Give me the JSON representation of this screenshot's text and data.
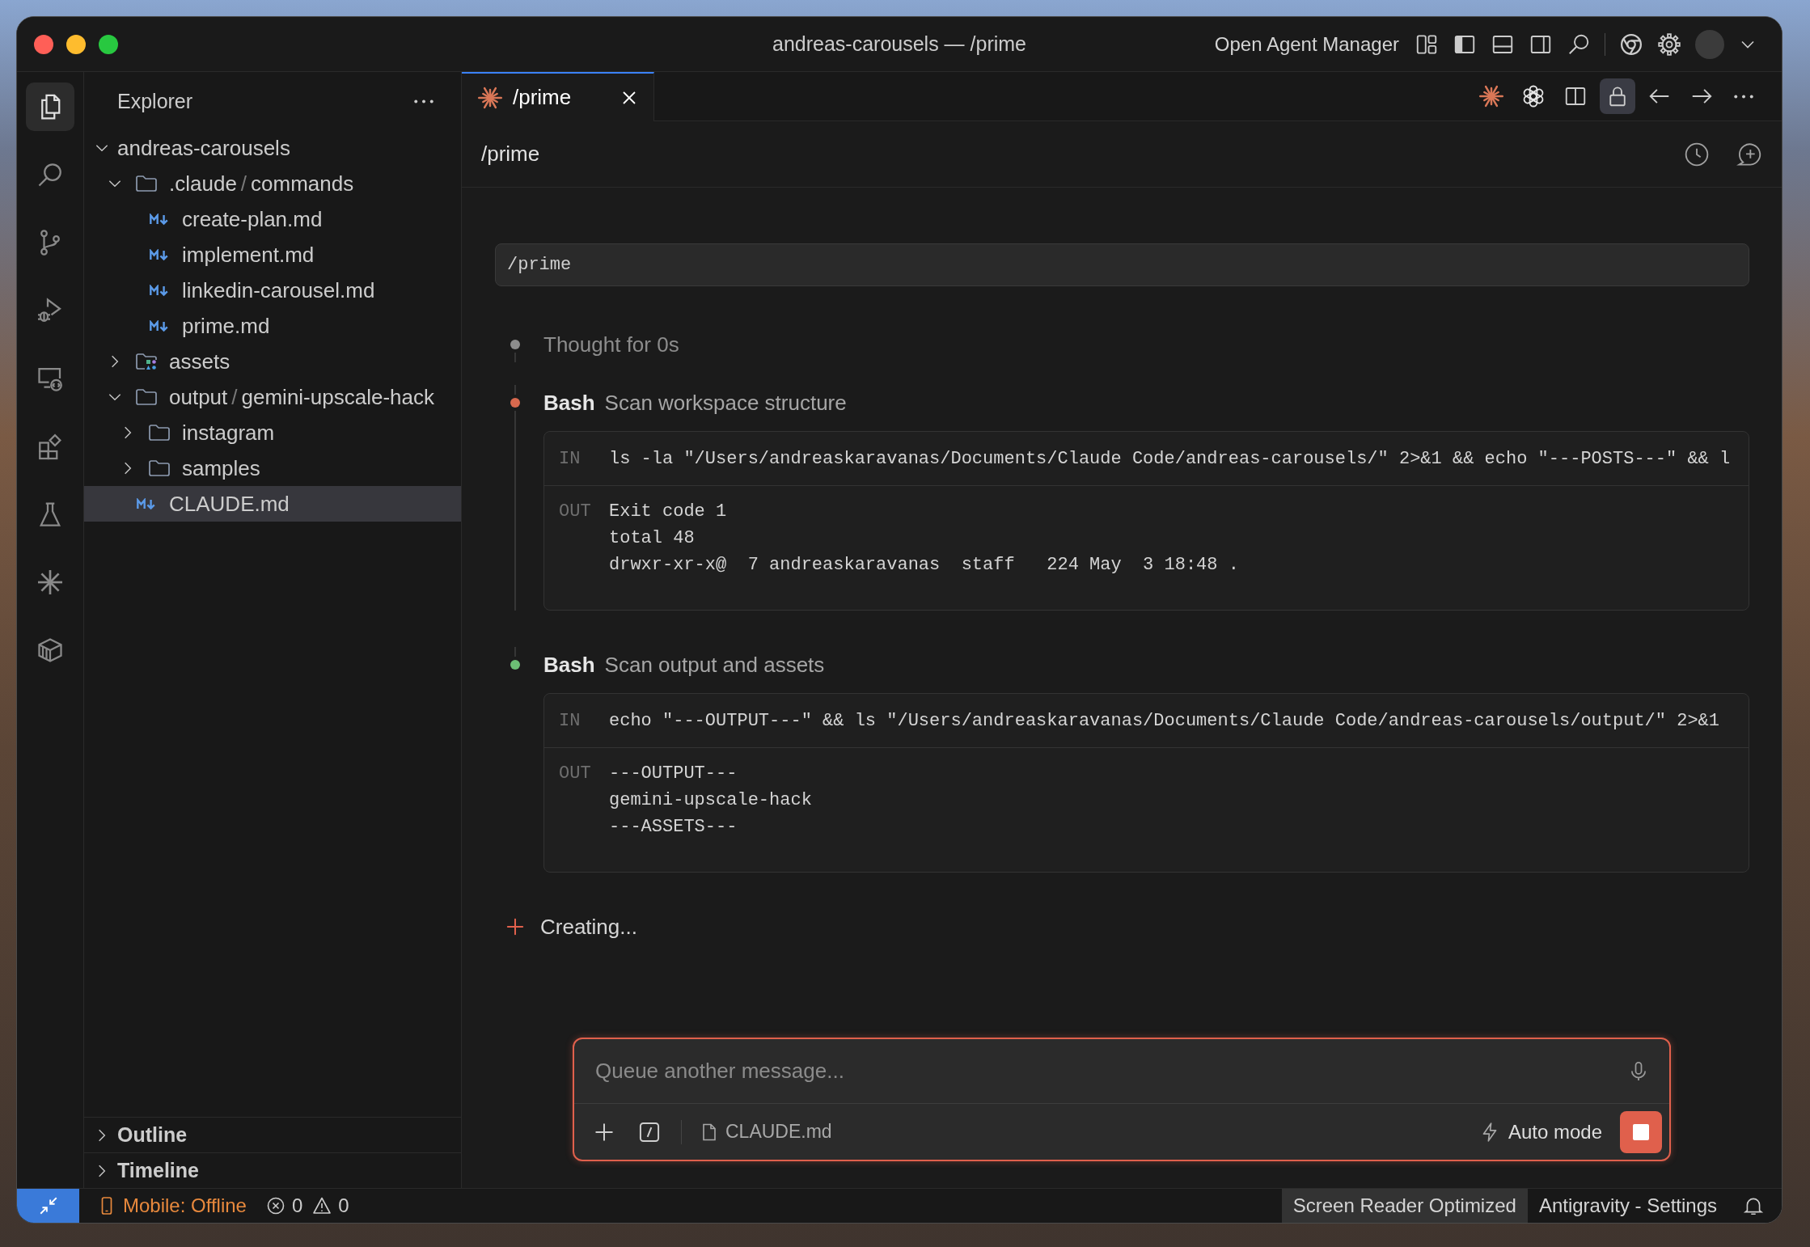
{
  "title_bar": {
    "title": "andreas-carousels — /prime",
    "agent_manager": "Open Agent Manager",
    "layout_toggles": [
      {
        "kind": "primary-sidebar",
        "on": true
      },
      {
        "kind": "panel",
        "on": false
      },
      {
        "kind": "secondary-sidebar",
        "on": false
      }
    ]
  },
  "activity_bar": {
    "items": [
      {
        "kind": "explorer",
        "selected": true
      },
      {
        "kind": "search",
        "selected": false
      },
      {
        "kind": "source-control",
        "selected": false
      },
      {
        "kind": "run-debug",
        "selected": false
      },
      {
        "kind": "remote-explorer",
        "selected": false
      },
      {
        "kind": "extensions",
        "selected": false
      },
      {
        "kind": "testing",
        "selected": false
      },
      {
        "kind": "agent",
        "selected": false
      },
      {
        "kind": "packages",
        "selected": false
      }
    ]
  },
  "sidebar": {
    "title": "Explorer",
    "separator": "/",
    "tree": [
      {
        "kind": "root",
        "label": "andreas-carousels",
        "expanded": true,
        "selected": false,
        "children": [
          {
            "kind": "folder",
            "path": [
              ".claude",
              "commands"
            ],
            "expanded": true,
            "selected": false,
            "children": [
              {
                "kind": "markdown",
                "label": "create-plan.md",
                "selected": false
              },
              {
                "kind": "markdown",
                "label": "implement.md",
                "selected": false
              },
              {
                "kind": "markdown",
                "label": "linkedin-carousel.md",
                "selected": false
              },
              {
                "kind": "markdown",
                "label": "prime.md",
                "selected": false
              }
            ]
          },
          {
            "kind": "media-folder",
            "path": [
              "assets"
            ],
            "expanded": false,
            "selected": false
          },
          {
            "kind": "folder",
            "path": [
              "output",
              "gemini-upscale-hack"
            ],
            "expanded": true,
            "selected": false,
            "children": [
              {
                "kind": "folder",
                "path": [
                  "instagram"
                ],
                "expanded": false,
                "selected": false
              },
              {
                "kind": "folder",
                "path": [
                  "samples"
                ],
                "expanded": false,
                "selected": false
              }
            ]
          },
          {
            "kind": "markdown",
            "label": "CLAUDE.md",
            "selected": true
          }
        ]
      }
    ],
    "sections": [
      {
        "label": "Outline",
        "expanded": false
      },
      {
        "label": "Timeline",
        "expanded": false
      }
    ]
  },
  "editor": {
    "tabs": [
      {
        "label": "/prime",
        "selected": true
      }
    ],
    "locked": true
  },
  "chat": {
    "title": "/prime",
    "prompt": "/prime",
    "steps": [
      {
        "kind": "thought",
        "text": "Thought for 0s",
        "color": "#8c8c8c"
      },
      {
        "kind": "tool",
        "tool": "Bash",
        "description": "Scan workspace structure",
        "color": "#d8694e",
        "in_label": "IN",
        "command": "ls -la \"/Users/andreaskaravanas/Documents/Claude Code/andreas-carousels/\" 2>&1 && echo \"---POSTS---\" && l",
        "out_label": "OUT",
        "output": [
          "Exit code 1",
          "total 48",
          "drwxr-xr-x@  7 andreaskaravanas  staff   224 May  3 18:48 ."
        ]
      },
      {
        "kind": "tool",
        "tool": "Bash",
        "description": "Scan output and assets",
        "color": "#6cbf74",
        "in_label": "IN",
        "command": "echo \"---OUTPUT---\" && ls \"/Users/andreaskaravanas/Documents/Claude Code/andreas-carousels/output/\" 2>&1",
        "out_label": "OUT",
        "output": [
          "---OUTPUT---",
          "gemini-upscale-hack",
          "---ASSETS---"
        ]
      }
    ],
    "progress": "Creating..."
  },
  "composer": {
    "placeholder": "Queue another message...",
    "attachment": "CLAUDE.md",
    "mode": "Auto mode"
  },
  "status_bar": {
    "mobile": "Mobile: Offline",
    "errors": "0",
    "warnings": "0",
    "right_items": [
      {
        "label": "Screen Reader Optimized",
        "highlighted": true
      },
      {
        "label": "Antigravity - Settings",
        "highlighted": false
      }
    ]
  }
}
